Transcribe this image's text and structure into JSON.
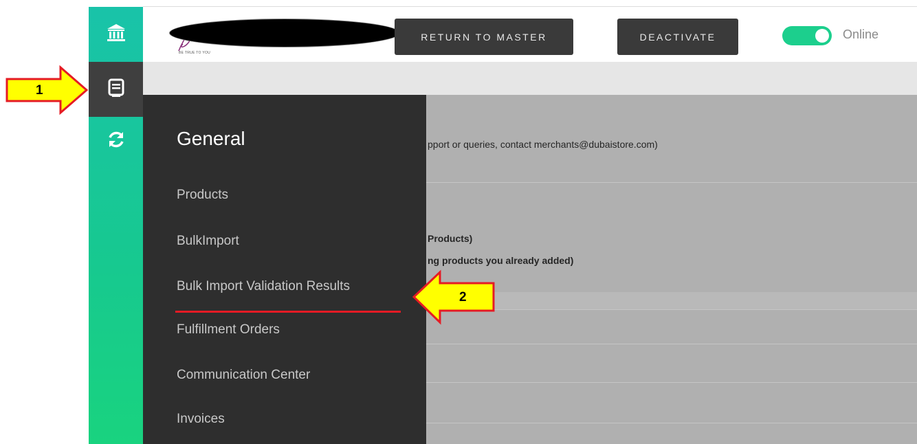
{
  "header": {
    "logo_tagline": "BE TRUE TO YOU",
    "return_label": "RETURN TO MASTER",
    "deactivate_label": "DEACTIVATE",
    "status_label": "Online",
    "status_on": true
  },
  "rail": {
    "icons": [
      "bank-icon",
      "document-list-icon",
      "sync-icon"
    ],
    "accent": "#17c98f"
  },
  "content": {
    "support_text": "pport or queries, contact merchants@dubaistore.com)",
    "products_text": "Products)",
    "existing_text": "ng products you already added)"
  },
  "menu": {
    "title": "General",
    "items": [
      "Products",
      "BulkImport",
      "Bulk Import Validation Results",
      "Fulfillment Orders",
      "Communication Center",
      "Invoices"
    ]
  },
  "annotations": {
    "step1": "1",
    "step2": "2",
    "arrow_fill": "#ffff00",
    "arrow_stroke": "#e51b24"
  }
}
